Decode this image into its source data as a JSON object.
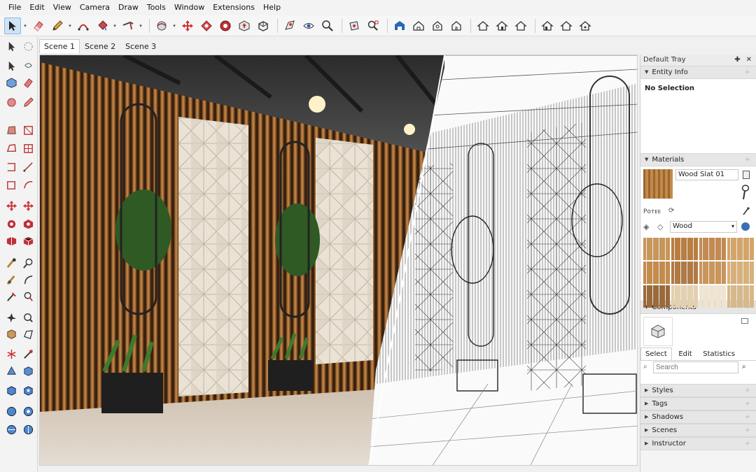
{
  "menu": [
    "File",
    "Edit",
    "View",
    "Camera",
    "Draw",
    "Tools",
    "Window",
    "Extensions",
    "Help"
  ],
  "scenes": {
    "tabs": [
      "Scene 1",
      "Scene 2",
      "Scene 3"
    ],
    "active": 0
  },
  "tray": {
    "title": "Default Tray",
    "pin_glyph": "✚",
    "close_glyph": "✕",
    "entity_info": {
      "header": "Entity Info",
      "status": "No Selection"
    },
    "materials": {
      "header": "Materials",
      "material_name": "Wood Slat 01",
      "collection": "Wood",
      "sub_icons_label": "Pᴏᴛᴇᴇ",
      "swatch_colors": [
        "#c8965a",
        "#b97d42",
        "#c28a52",
        "#d4a468",
        "#c48c4c",
        "#b07a44",
        "#c9955b",
        "#d8b07a",
        "#9a6a3a",
        "#e4cfae",
        "#efe4cf",
        "#d7b88a"
      ]
    },
    "components": {
      "header": "Components",
      "tabs": [
        "Select",
        "Edit",
        "Statistics"
      ],
      "search_placeholder": "Search"
    },
    "collapsed_panels": [
      "Styles",
      "Tags",
      "Shadows",
      "Scenes",
      "Instructor"
    ]
  },
  "icons": {
    "select": "select-arrow-icon",
    "eraser": "eraser-icon",
    "pencil": "pencil-icon",
    "paint": "paint-bucket-icon",
    "orbit": "orbit-icon",
    "pan": "pan-icon",
    "zoom": "zoom-icon",
    "house": "house-view-icon"
  },
  "colors": {
    "accent": "#cfe3f7",
    "wood_warm": "#b47a3e"
  }
}
